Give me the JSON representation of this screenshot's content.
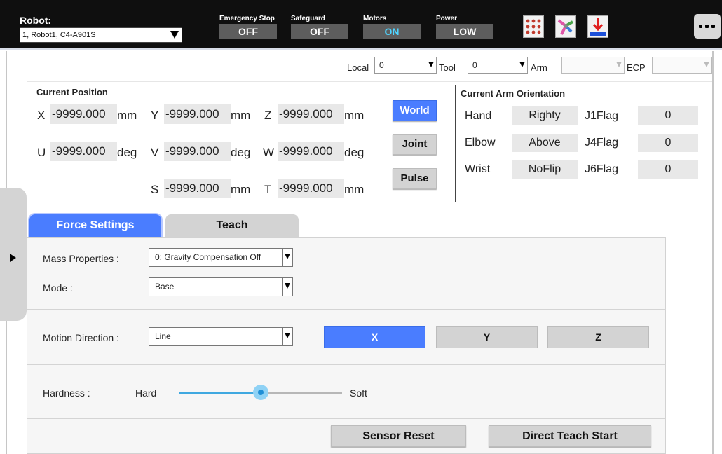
{
  "header": {
    "robot_label": "Robot:",
    "robot_value": "1, Robot1, C4-A901S",
    "statuses": [
      {
        "label": "Emergency Stop",
        "value": "OFF"
      },
      {
        "label": "Safeguard",
        "value": "OFF"
      },
      {
        "label": "Motors",
        "value": "ON",
        "value_color": "#4fd4ff"
      },
      {
        "label": "Power",
        "value": "LOW"
      }
    ],
    "icons": [
      "io-grid-icon",
      "robot-arm-icon",
      "download-arrow-icon"
    ],
    "more_icon": "more-icon"
  },
  "coordinates": {
    "local_label": "Local",
    "local_value": "0",
    "tool_label": "Tool",
    "tool_value": "0",
    "arm_label": "Arm",
    "arm_value": "",
    "ecp_label": "ECP",
    "ecp_value": ""
  },
  "position": {
    "title": "Current Position",
    "rows": [
      [
        {
          "axis": "X",
          "value": "-9999.000",
          "unit": "mm"
        },
        {
          "axis": "Y",
          "value": "-9999.000",
          "unit": "mm"
        },
        {
          "axis": "Z",
          "value": "-9999.000",
          "unit": "mm"
        }
      ],
      [
        {
          "axis": "U",
          "value": "-9999.000",
          "unit": "deg"
        },
        {
          "axis": "V",
          "value": "-9999.000",
          "unit": "deg"
        },
        {
          "axis": "W",
          "value": "-9999.000",
          "unit": "deg"
        }
      ],
      [
        {
          "axis": "S",
          "value": "-9999.000",
          "unit": "mm"
        },
        {
          "axis": "T",
          "value": "-9999.000",
          "unit": "mm"
        }
      ]
    ],
    "modes": [
      "World",
      "Joint",
      "Pulse"
    ],
    "active_mode": "World"
  },
  "orientation": {
    "title": "Current Arm Orientation",
    "rows": [
      {
        "label": "Hand",
        "value": "Righty",
        "flag_label": "J1Flag",
        "flag_value": "0"
      },
      {
        "label": "Elbow",
        "value": "Above",
        "flag_label": "J4Flag",
        "flag_value": "0"
      },
      {
        "label": "Wrist",
        "value": "NoFlip",
        "flag_label": "J6Flag",
        "flag_value": "0"
      }
    ]
  },
  "tabs": [
    {
      "label": "Force Settings",
      "active": true
    },
    {
      "label": "Teach",
      "active": false
    }
  ],
  "force": {
    "mass_label": "Mass Properties :",
    "mass_value": "0: Gravity Compensation Off",
    "mode_label": "Mode :",
    "mode_value": "Base",
    "motion_label": "Motion Direction :",
    "motion_value": "Line",
    "directions": [
      "X",
      "Y",
      "Z"
    ],
    "active_direction": "X",
    "hardness_label": "Hardness :",
    "hard_label": "Hard",
    "soft_label": "Soft",
    "hardness_level": 0.5,
    "sensor_reset": "Sensor Reset",
    "direct_teach": "Direct Teach Start"
  },
  "colors": {
    "accent": "#4a7dff",
    "topbar": "#0f0f0f",
    "motors_on": "#4fd4ff"
  }
}
